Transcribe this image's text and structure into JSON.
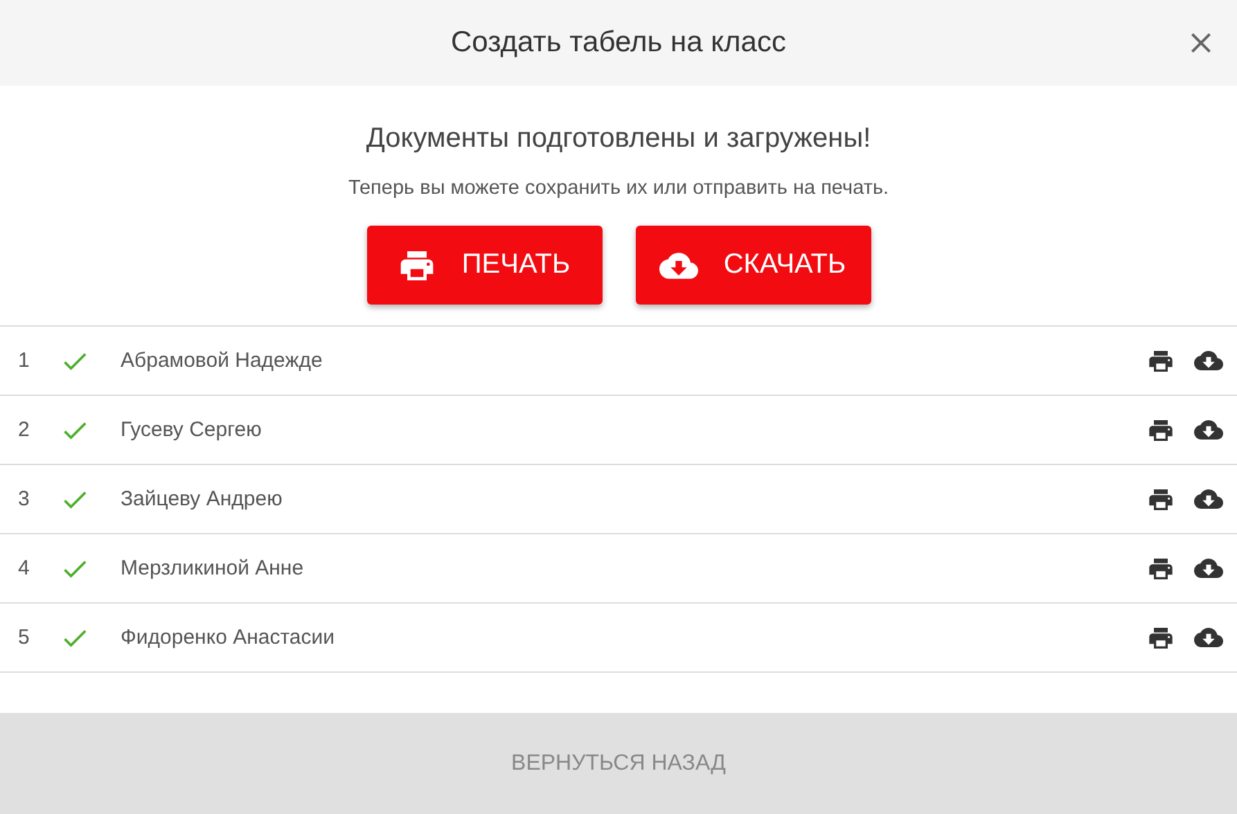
{
  "dialog": {
    "title": "Создать табель на класс"
  },
  "message": {
    "heading": "Документы подготовлены и загружены!",
    "text": "Теперь вы можете сохранить их или отправить на печать."
  },
  "actions": [
    {
      "kind": "print",
      "label": "ПЕЧАТЬ"
    },
    {
      "kind": "download",
      "label": "СКАЧАТЬ"
    }
  ],
  "rows": [
    {
      "number": "1",
      "name": "Абрамовой Надежде",
      "done": true
    },
    {
      "number": "2",
      "name": "Гусеву Сергею",
      "done": true
    },
    {
      "number": "3",
      "name": "Зайцеву Андрею",
      "done": true
    },
    {
      "number": "4",
      "name": "Мерзликиной Анне",
      "done": true
    },
    {
      "number": "5",
      "name": "Фидоренко Анастасии",
      "done": true
    }
  ],
  "footer": {
    "button": "ВЕРНУТЬСЯ НАЗАД"
  }
}
